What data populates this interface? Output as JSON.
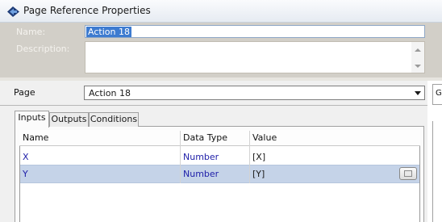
{
  "window": {
    "title": "Page Reference Properties",
    "title_icon": "diamond-arrow-icon"
  },
  "form": {
    "name_label": "Name:",
    "name_value": "Action 18",
    "description_label": "Description:",
    "description_value": ""
  },
  "page_select": {
    "label": "Page",
    "value": "Action 18"
  },
  "tabs": [
    {
      "label": "Inputs",
      "active": true
    },
    {
      "label": "Outputs",
      "active": false
    },
    {
      "label": "Conditions",
      "active": false
    }
  ],
  "grid": {
    "columns": [
      "Name",
      "Data Type",
      "Value"
    ],
    "rows": [
      {
        "name": "X",
        "data_type": "Number",
        "value": "[X]",
        "selected": false
      },
      {
        "name": "Y",
        "data_type": "Number",
        "value": "[Y]",
        "selected": true
      }
    ]
  },
  "colors": {
    "selection": "#3d7bd0",
    "selected_row": "#c5d3e8",
    "header_bg": "#d2cfc8"
  }
}
